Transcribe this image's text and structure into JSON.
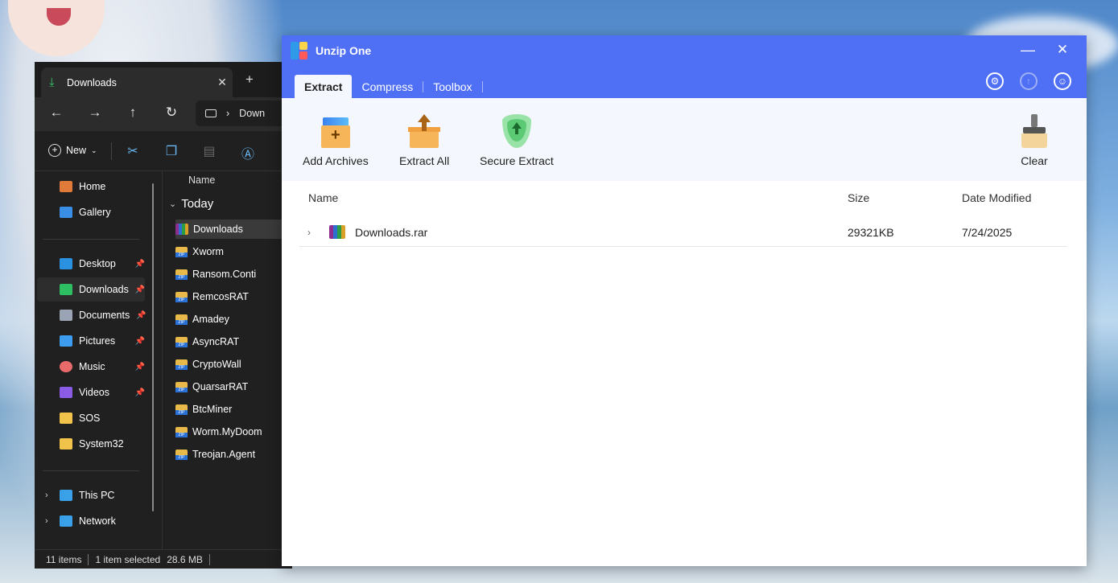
{
  "explorer": {
    "tab_title": "Downloads",
    "tab_close": "✕",
    "new_tab": "+",
    "address_text": "Down",
    "toolbar": {
      "new_label": "New"
    },
    "sidebar": {
      "quick": [
        {
          "label": "Home",
          "icon": "home-icon",
          "color": "#e07a3a"
        },
        {
          "label": "Gallery",
          "icon": "gallery-icon",
          "color": "#3a8ee6"
        }
      ],
      "pinned": [
        {
          "label": "Desktop",
          "icon": "desktop-icon",
          "color": "#2a90e0"
        },
        {
          "label": "Downloads",
          "icon": "download-icon",
          "color": "#2fbf63"
        },
        {
          "label": "Documents",
          "icon": "documents-icon",
          "color": "#9aa4b5"
        },
        {
          "label": "Pictures",
          "icon": "pictures-icon",
          "color": "#3b9cf0"
        },
        {
          "label": "Music",
          "icon": "music-icon",
          "color": "#e86a6a"
        },
        {
          "label": "Videos",
          "icon": "videos-icon",
          "color": "#8a5ce6"
        },
        {
          "label": "SOS",
          "icon": "folder-icon",
          "color": "#f1c34b"
        },
        {
          "label": "System32",
          "icon": "folder-icon",
          "color": "#f1c34b"
        }
      ],
      "devices": [
        {
          "label": "This PC",
          "icon": "pc-icon",
          "color": "#3aa0e8"
        },
        {
          "label": "Network",
          "icon": "network-icon",
          "color": "#3aa0e8"
        }
      ]
    },
    "content": {
      "column_name": "Name",
      "group": "Today",
      "files": [
        {
          "name": "Downloads",
          "type": "rar"
        },
        {
          "name": "Xworm",
          "type": "zip"
        },
        {
          "name": "Ransom.Conti",
          "type": "zip"
        },
        {
          "name": "RemcosRAT",
          "type": "zip"
        },
        {
          "name": "Amadey",
          "type": "zip"
        },
        {
          "name": "AsyncRAT",
          "type": "zip"
        },
        {
          "name": "CryptoWall",
          "type": "zip"
        },
        {
          "name": "QuarsarRAT",
          "type": "zip"
        },
        {
          "name": "BtcMiner",
          "type": "zip"
        },
        {
          "name": "Worm.MyDoom",
          "type": "zip"
        },
        {
          "name": "Treojan.Agent",
          "type": "zip"
        }
      ]
    },
    "status": {
      "items": "11 items",
      "selected": "1 item selected",
      "size": "28.6 MB"
    }
  },
  "unzip": {
    "title": "Unzip One",
    "tabs": [
      "Extract",
      "Compress",
      "Toolbox"
    ],
    "ribbon": {
      "add": "Add Archives",
      "extract_all": "Extract All",
      "secure": "Secure Extract",
      "clear": "Clear"
    },
    "table": {
      "headers": {
        "name": "Name",
        "size": "Size",
        "date": "Date Modified"
      },
      "rows": [
        {
          "name": "Downloads.rar",
          "size": "29321KB",
          "date": "7/24/2025"
        }
      ]
    },
    "colors": {
      "titlebar": "#4f6ff5",
      "ribbon_bg": "#f4f7fd"
    }
  }
}
